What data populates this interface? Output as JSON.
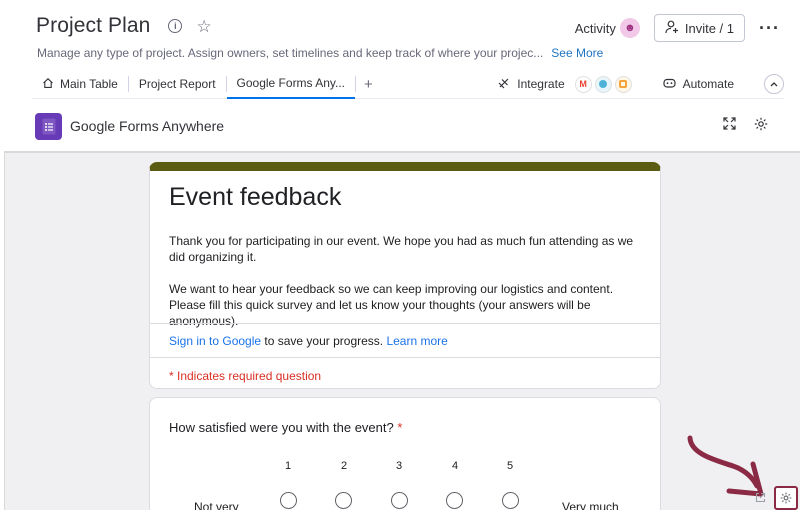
{
  "header": {
    "title": "Project Plan",
    "description": "Manage any type of project. Assign owners, set timelines and keep track of where your projec...",
    "see_more": "See More",
    "activity": "Activity",
    "invite": "Invite / 1",
    "more": "···"
  },
  "tabs": [
    {
      "label": "Main Table",
      "icon": "home-icon"
    },
    {
      "label": "Project Report"
    },
    {
      "label": "Google Forms Any...",
      "active": true
    },
    {
      "label": "+"
    }
  ],
  "toolbar": {
    "integrate": "Integrate",
    "automate": "Automate"
  },
  "app": {
    "name": "Google Forms Anywhere"
  },
  "form": {
    "title": "Event feedback",
    "intro1": "Thank you for participating in our event. We hope you had as much fun attending as we did organizing it.",
    "intro2": "We want to hear your feedback so we can keep improving our logistics and content. Please fill this quick survey and let us know your thoughts (your answers will be anonymous).",
    "signin_link": "Sign in to Google",
    "signin_text": " to save your progress. ",
    "learn_more": "Learn more",
    "required_note": "* Indicates required question",
    "question": "How satisfied were you with the event?",
    "required_mark": " *",
    "scale": [
      "1",
      "2",
      "3",
      "4",
      "5"
    ],
    "scale_low": "Not very",
    "scale_high": "Very much"
  },
  "colors": {
    "form_accent": "#5b5b13",
    "link": "#1a73e8",
    "required": "#d93025",
    "annotation": "#8b2a44"
  }
}
